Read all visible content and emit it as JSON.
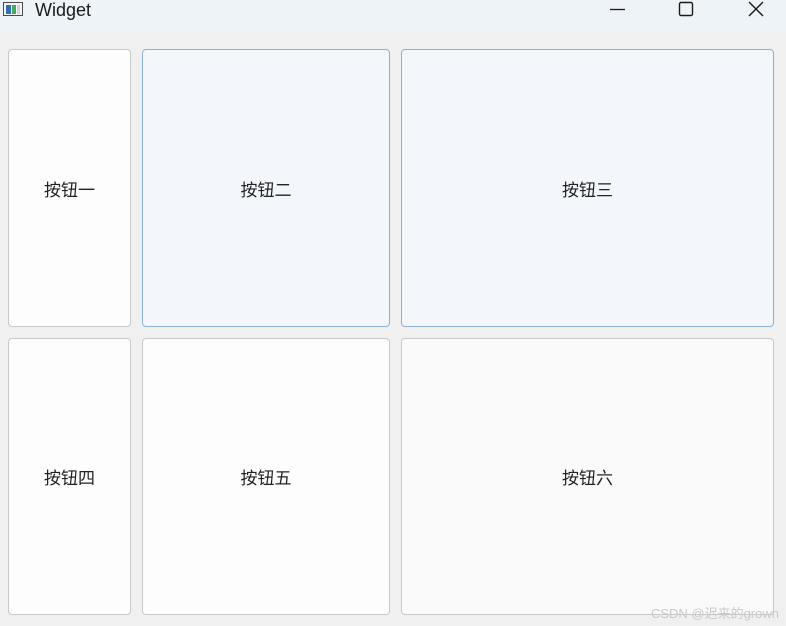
{
  "window": {
    "title": "Widget",
    "icon": "app-window-icon",
    "controls": {
      "minimize_icon": "minimize-icon",
      "maximize_icon": "maximize-icon",
      "close_icon": "close-icon"
    }
  },
  "buttons": [
    {
      "label": "按钮一",
      "state": "normal"
    },
    {
      "label": "按钮二",
      "state": "hover"
    },
    {
      "label": "按钮三",
      "state": "hover"
    },
    {
      "label": "按钮四",
      "state": "normal"
    },
    {
      "label": "按钮五",
      "state": "normal"
    },
    {
      "label": "按钮六",
      "state": "normal"
    }
  ],
  "watermark": "CSDN @迟来的grown",
  "colors": {
    "window_bg": "#f0f0f0",
    "titlebar_bg": "#eef3f8",
    "button_bg": "#fdfdfd",
    "button_border": "#c9c9c9",
    "hover_bg": "#f3f7fc",
    "hover_border": "#8cb0d8"
  }
}
